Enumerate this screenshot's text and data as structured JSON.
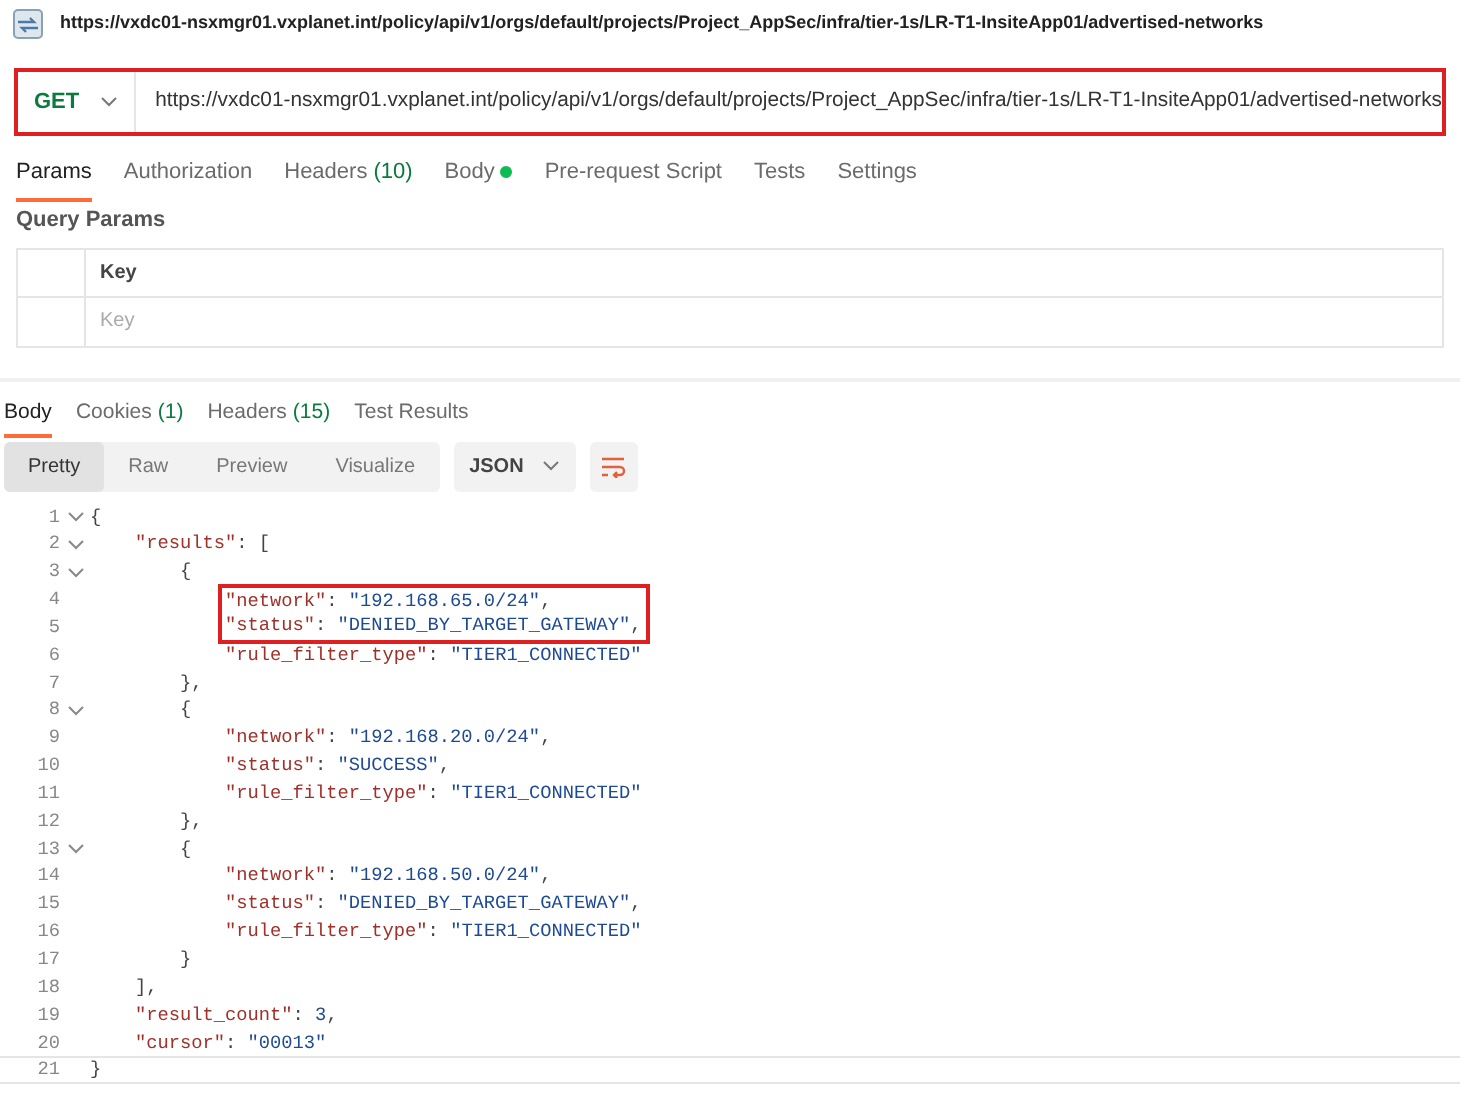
{
  "request_title": "https://vxdc01-nsxmgr01.vxplanet.int/policy/api/v1/orgs/default/projects/Project_AppSec/infra/tier-1s/LR-T1-InsiteApp01/advertised-networks",
  "request_bar": {
    "method": "GET",
    "url": "https://vxdc01-nsxmgr01.vxplanet.int/policy/api/v1/orgs/default/projects/Project_AppSec/infra/tier-1s/LR-T1-InsiteApp01/advertised-networks",
    "highlighted": true
  },
  "request_tabs": [
    {
      "label": "Params",
      "dot": false,
      "selected": true
    },
    {
      "label": "Authorization",
      "dot": false,
      "selected": false
    },
    {
      "label": "Headers",
      "count": "(10)",
      "dot": false,
      "selected": false
    },
    {
      "label": "Body",
      "dot": true,
      "selected": false
    },
    {
      "label": "Pre-request Script",
      "dot": false,
      "selected": false
    },
    {
      "label": "Tests",
      "dot": false,
      "selected": false
    },
    {
      "label": "Settings",
      "dot": false,
      "selected": false
    }
  ],
  "query_params": {
    "title": "Query Params",
    "header": "Key",
    "placeholder": "Key"
  },
  "response_tabs": [
    {
      "label": "Body",
      "selected": true
    },
    {
      "label": "Cookies",
      "count": "(1)",
      "selected": false
    },
    {
      "label": "Headers",
      "count": "(15)",
      "selected": false
    },
    {
      "label": "Test Results",
      "selected": false
    }
  ],
  "view_modes": [
    {
      "label": "Pretty",
      "selected": true
    },
    {
      "label": "Raw",
      "selected": false
    },
    {
      "label": "Preview",
      "selected": false
    },
    {
      "label": "Visualize",
      "selected": false
    }
  ],
  "format": "JSON",
  "code_lines": [
    {
      "number": "1",
      "fold": true,
      "highlighted": false,
      "parts": [
        {
          "kind": "punct",
          "text": "{"
        }
      ]
    },
    {
      "number": "2",
      "fold": true,
      "highlighted": false,
      "parts": [
        {
          "kind": "key",
          "text": "    \"results\""
        },
        {
          "kind": "punct",
          "text": ": ["
        }
      ]
    },
    {
      "number": "3",
      "fold": true,
      "highlighted": false,
      "parts": [
        {
          "kind": "punct",
          "text": "        {"
        }
      ]
    },
    {
      "number": "4",
      "fold": false,
      "highlighted": true,
      "parts": [
        {
          "kind": "key",
          "text": "            \"network\""
        },
        {
          "kind": "punct",
          "text": ": "
        },
        {
          "kind": "string",
          "text": "\"192.168.65.0/24\""
        },
        {
          "kind": "punct",
          "text": ","
        }
      ]
    },
    {
      "number": "5",
      "fold": false,
      "highlighted": true,
      "parts": [
        {
          "kind": "key",
          "text": "            \"status\""
        },
        {
          "kind": "punct",
          "text": ": "
        },
        {
          "kind": "string",
          "text": "\"DENIED_BY_TARGET_GATEWAY\""
        },
        {
          "kind": "punct",
          "text": ","
        }
      ]
    },
    {
      "number": "6",
      "fold": false,
      "highlighted": false,
      "parts": [
        {
          "kind": "key",
          "text": "            \"rule_filter_type\""
        },
        {
          "kind": "punct",
          "text": ": "
        },
        {
          "kind": "string",
          "text": "\"TIER1_CONNECTED\""
        }
      ]
    },
    {
      "number": "7",
      "fold": false,
      "highlighted": false,
      "parts": [
        {
          "kind": "punct",
          "text": "        },"
        }
      ]
    },
    {
      "number": "8",
      "fold": true,
      "highlighted": false,
      "parts": [
        {
          "kind": "punct",
          "text": "        {"
        }
      ]
    },
    {
      "number": "9",
      "fold": false,
      "highlighted": false,
      "parts": [
        {
          "kind": "key",
          "text": "            \"network\""
        },
        {
          "kind": "punct",
          "text": ": "
        },
        {
          "kind": "string",
          "text": "\"192.168.20.0/24\""
        },
        {
          "kind": "punct",
          "text": ","
        }
      ]
    },
    {
      "number": "10",
      "fold": false,
      "highlighted": false,
      "parts": [
        {
          "kind": "key",
          "text": "            \"status\""
        },
        {
          "kind": "punct",
          "text": ": "
        },
        {
          "kind": "string",
          "text": "\"SUCCESS\""
        },
        {
          "kind": "punct",
          "text": ","
        }
      ]
    },
    {
      "number": "11",
      "fold": false,
      "highlighted": false,
      "parts": [
        {
          "kind": "key",
          "text": "            \"rule_filter_type\""
        },
        {
          "kind": "punct",
          "text": ": "
        },
        {
          "kind": "string",
          "text": "\"TIER1_CONNECTED\""
        }
      ]
    },
    {
      "number": "12",
      "fold": false,
      "highlighted": false,
      "parts": [
        {
          "kind": "punct",
          "text": "        },"
        }
      ]
    },
    {
      "number": "13",
      "fold": true,
      "highlighted": false,
      "parts": [
        {
          "kind": "punct",
          "text": "        {"
        }
      ]
    },
    {
      "number": "14",
      "fold": false,
      "highlighted": false,
      "parts": [
        {
          "kind": "key",
          "text": "            \"network\""
        },
        {
          "kind": "punct",
          "text": ": "
        },
        {
          "kind": "string",
          "text": "\"192.168.50.0/24\""
        },
        {
          "kind": "punct",
          "text": ","
        }
      ]
    },
    {
      "number": "15",
      "fold": false,
      "highlighted": false,
      "parts": [
        {
          "kind": "key",
          "text": "            \"status\""
        },
        {
          "kind": "punct",
          "text": ": "
        },
        {
          "kind": "string",
          "text": "\"DENIED_BY_TARGET_GATEWAY\""
        },
        {
          "kind": "punct",
          "text": ","
        }
      ]
    },
    {
      "number": "16",
      "fold": false,
      "highlighted": false,
      "parts": [
        {
          "kind": "key",
          "text": "            \"rule_filter_type\""
        },
        {
          "kind": "punct",
          "text": ": "
        },
        {
          "kind": "string",
          "text": "\"TIER1_CONNECTED\""
        }
      ]
    },
    {
      "number": "17",
      "fold": false,
      "highlighted": false,
      "parts": [
        {
          "kind": "punct",
          "text": "        }"
        }
      ]
    },
    {
      "number": "18",
      "fold": false,
      "highlighted": false,
      "parts": [
        {
          "kind": "punct",
          "text": "    ],"
        }
      ]
    },
    {
      "number": "19",
      "fold": false,
      "highlighted": false,
      "parts": [
        {
          "kind": "key",
          "text": "    \"result_count\""
        },
        {
          "kind": "punct",
          "text": ": "
        },
        {
          "kind": "number",
          "text": "3"
        },
        {
          "kind": "punct",
          "text": ","
        }
      ]
    },
    {
      "number": "20",
      "fold": false,
      "highlighted": false,
      "parts": [
        {
          "kind": "key",
          "text": "    \"cursor\""
        },
        {
          "kind": "punct",
          "text": ": "
        },
        {
          "kind": "string",
          "text": "\"00013\""
        }
      ]
    },
    {
      "number": "21",
      "fold": false,
      "highlighted": false,
      "parts": [
        {
          "kind": "punct",
          "text": "}"
        }
      ]
    }
  ]
}
